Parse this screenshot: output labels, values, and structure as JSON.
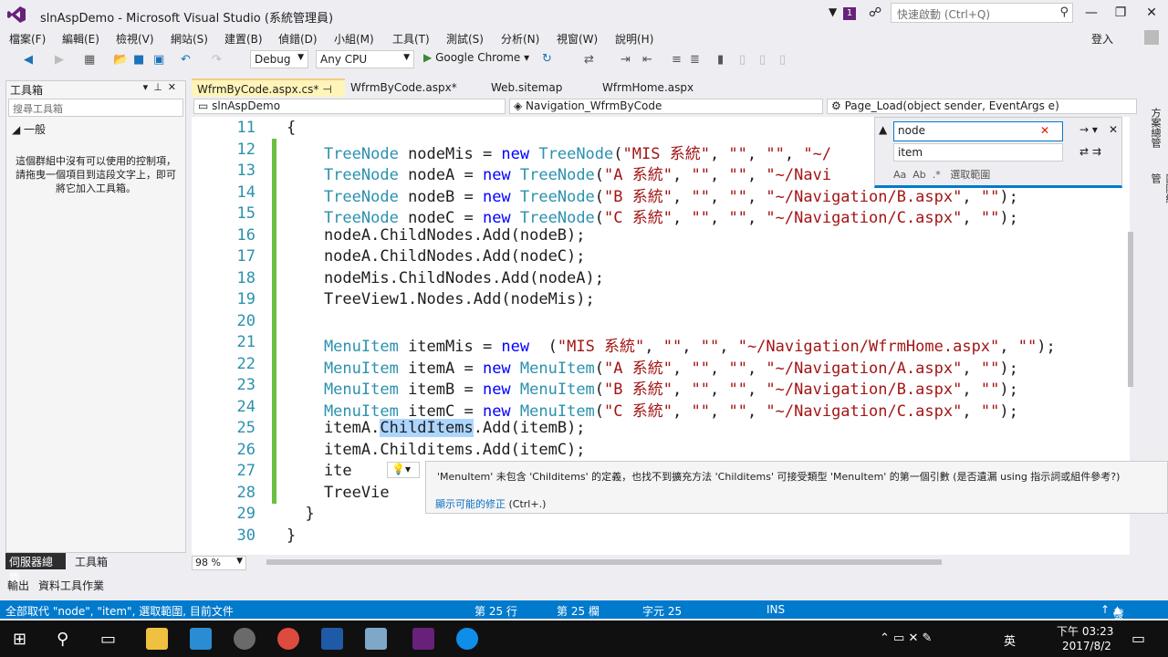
{
  "window": {
    "title": "slnAspDemo - Microsoft Visual Studio (系統管理員)",
    "notification_count": "1",
    "quick_launch_placeholder": "快速啟動 (Ctrl+Q)",
    "sign_in": "登入"
  },
  "menu": [
    "檔案(F)",
    "編輯(E)",
    "檢視(V)",
    "網站(S)",
    "建置(B)",
    "偵錯(D)",
    "小組(M)",
    "工具(T)",
    "測試(S)",
    "分析(N)",
    "視窗(W)",
    "說明(H)"
  ],
  "toolbar": {
    "config": "Debug",
    "platform": "Any CPU",
    "run_target": "Google Chrome"
  },
  "toolbox": {
    "title": "工具箱",
    "search_placeholder": "搜尋工具箱",
    "group": "一般",
    "empty_message": "這個群組中沒有可以使用的控制項，請拖曳一個項目到這段文字上，即可將它加入工具箱。"
  },
  "bottom_tabs": [
    "伺服器總管",
    "工具箱"
  ],
  "pane_tabs": [
    "輸出",
    "資料工具作業"
  ],
  "file_tabs": [
    {
      "label": "WfrmByCode.aspx.cs*",
      "active": true
    },
    {
      "label": "WfrmByCode.aspx*",
      "active": false
    },
    {
      "label": "Web.sitemap",
      "active": false
    },
    {
      "label": "WfrmHome.aspx",
      "active": false
    }
  ],
  "navbar": {
    "project": "slnAspDemo",
    "class": "Navigation_WfrmByCode",
    "member": "Page_Load(object sender, EventArgs e)"
  },
  "code_lines": [
    {
      "n": "11",
      "parts": [
        [
          "",
          "{"
        ]
      ]
    },
    {
      "n": "12",
      "parts": [
        [
          "ty",
          "    TreeNode"
        ],
        [
          "",
          " nodeMis = "
        ],
        [
          "kw",
          "new"
        ],
        [
          "ty",
          " TreeNode"
        ],
        [
          "",
          "("
        ],
        [
          "st",
          "\"MIS 系統\""
        ],
        [
          "",
          ", "
        ],
        [
          "st",
          "\"\""
        ],
        [
          "",
          ", "
        ],
        [
          "st",
          "\"\""
        ],
        [
          "",
          ", "
        ],
        [
          "st",
          "\"~/"
        ]
      ]
    },
    {
      "n": "13",
      "parts": [
        [
          "ty",
          "    TreeNode"
        ],
        [
          "",
          " nodeA = "
        ],
        [
          "kw",
          "new"
        ],
        [
          "ty",
          " TreeNode"
        ],
        [
          "",
          "("
        ],
        [
          "st",
          "\"A 系統\""
        ],
        [
          "",
          ", "
        ],
        [
          "st",
          "\"\""
        ],
        [
          "",
          ", "
        ],
        [
          "st",
          "\"\""
        ],
        [
          "",
          ", "
        ],
        [
          "st",
          "\"~/Navi"
        ]
      ]
    },
    {
      "n": "14",
      "parts": [
        [
          "ty",
          "    TreeNode"
        ],
        [
          "",
          " nodeB = "
        ],
        [
          "kw",
          "new"
        ],
        [
          "ty",
          " TreeNode"
        ],
        [
          "",
          "("
        ],
        [
          "st",
          "\"B 系統\""
        ],
        [
          "",
          ", "
        ],
        [
          "st",
          "\"\""
        ],
        [
          "",
          ", "
        ],
        [
          "st",
          "\"\""
        ],
        [
          "",
          ", "
        ],
        [
          "st",
          "\"~/Navigation/B.aspx\""
        ],
        [
          "",
          ", "
        ],
        [
          "st",
          "\"\""
        ],
        [
          "",
          ");"
        ]
      ]
    },
    {
      "n": "15",
      "parts": [
        [
          "ty",
          "    TreeNode"
        ],
        [
          "",
          " nodeC = "
        ],
        [
          "kw",
          "new"
        ],
        [
          "ty",
          " TreeNode"
        ],
        [
          "",
          "("
        ],
        [
          "st",
          "\"C 系統\""
        ],
        [
          "",
          ", "
        ],
        [
          "st",
          "\"\""
        ],
        [
          "",
          ", "
        ],
        [
          "st",
          "\"\""
        ],
        [
          "",
          ", "
        ],
        [
          "st",
          "\"~/Navigation/C.aspx\""
        ],
        [
          "",
          ", "
        ],
        [
          "st",
          "\"\""
        ],
        [
          "",
          ");"
        ]
      ]
    },
    {
      "n": "16",
      "parts": [
        [
          "",
          "    nodeA.ChildNodes.Add(nodeB);"
        ]
      ]
    },
    {
      "n": "17",
      "parts": [
        [
          "",
          "    nodeA.ChildNodes.Add(nodeC);"
        ]
      ]
    },
    {
      "n": "18",
      "parts": [
        [
          "",
          "    nodeMis.ChildNodes.Add(nodeA);"
        ]
      ]
    },
    {
      "n": "19",
      "parts": [
        [
          "",
          "    TreeView1.Nodes.Add(nodeMis);"
        ]
      ]
    },
    {
      "n": "20",
      "parts": [
        [
          "",
          ""
        ]
      ]
    },
    {
      "n": "21",
      "parts": [
        [
          "ty",
          "    MenuItem"
        ],
        [
          "",
          " itemMis = "
        ],
        [
          "kw",
          "new"
        ],
        [
          "",
          "  ("
        ],
        [
          "st",
          "\"MIS 系統\""
        ],
        [
          "",
          ", "
        ],
        [
          "st",
          "\"\""
        ],
        [
          "",
          ", "
        ],
        [
          "st",
          "\"\""
        ],
        [
          "",
          ", "
        ],
        [
          "st",
          "\"~/Navigation/WfrmHome.aspx\""
        ],
        [
          "",
          ", "
        ],
        [
          "st",
          "\"\""
        ],
        [
          "",
          ");"
        ]
      ]
    },
    {
      "n": "22",
      "parts": [
        [
          "ty",
          "    MenuItem"
        ],
        [
          "",
          " itemA = "
        ],
        [
          "kw",
          "new"
        ],
        [
          "ty",
          " MenuItem"
        ],
        [
          "",
          "("
        ],
        [
          "st",
          "\"A 系統\""
        ],
        [
          "",
          ", "
        ],
        [
          "st",
          "\"\""
        ],
        [
          "",
          ", "
        ],
        [
          "st",
          "\"\""
        ],
        [
          "",
          ", "
        ],
        [
          "st",
          "\"~/Navigation/A.aspx\""
        ],
        [
          "",
          ", "
        ],
        [
          "st",
          "\"\""
        ],
        [
          "",
          ");"
        ]
      ]
    },
    {
      "n": "23",
      "parts": [
        [
          "ty",
          "    MenuItem"
        ],
        [
          "",
          " itemB = "
        ],
        [
          "kw",
          "new"
        ],
        [
          "ty",
          " MenuItem"
        ],
        [
          "",
          "("
        ],
        [
          "st",
          "\"B 系統\""
        ],
        [
          "",
          ", "
        ],
        [
          "st",
          "\"\""
        ],
        [
          "",
          ", "
        ],
        [
          "st",
          "\"\""
        ],
        [
          "",
          ", "
        ],
        [
          "st",
          "\"~/Navigation/B.aspx\""
        ],
        [
          "",
          ", "
        ],
        [
          "st",
          "\"\""
        ],
        [
          "",
          ");"
        ]
      ]
    },
    {
      "n": "24",
      "parts": [
        [
          "ty",
          "    MenuItem"
        ],
        [
          "",
          " itemC = "
        ],
        [
          "kw",
          "new"
        ],
        [
          "ty",
          " MenuItem"
        ],
        [
          "",
          "("
        ],
        [
          "st",
          "\"C 系統\""
        ],
        [
          "",
          ", "
        ],
        [
          "st",
          "\"\""
        ],
        [
          "",
          ", "
        ],
        [
          "st",
          "\"\""
        ],
        [
          "",
          ", "
        ],
        [
          "st",
          "\"~/Navigation/C.aspx\""
        ],
        [
          "",
          ", "
        ],
        [
          "st",
          "\"\""
        ],
        [
          "",
          ");"
        ]
      ]
    },
    {
      "n": "25",
      "parts": [
        [
          "",
          "    itemA."
        ],
        [
          "sel",
          "ChildItems"
        ],
        [
          "",
          ".Add(itemB);"
        ]
      ]
    },
    {
      "n": "26",
      "parts": [
        [
          "",
          "    itemA.Childitems.Add(itemC);"
        ]
      ]
    },
    {
      "n": "27",
      "parts": [
        [
          "",
          "    ite"
        ]
      ]
    },
    {
      "n": "28",
      "parts": [
        [
          "",
          "    TreeVie"
        ]
      ]
    },
    {
      "n": "29",
      "parts": [
        [
          "",
          "  }"
        ]
      ]
    },
    {
      "n": "30",
      "parts": [
        [
          "",
          "}"
        ]
      ]
    }
  ],
  "find": {
    "search": "node",
    "replace": "item",
    "scope": "選取範圍"
  },
  "tooltip": {
    "message": "'MenuItem' 未包含 'Childitems' 的定義，也找不到擴充方法 'Childitems' 可接受類型 'MenuItem' 的第一個引數 (是否遺漏 using 指示詞或組件參考?)",
    "fix_link": "顯示可能的修正",
    "fix_shortcut": "(Ctrl+.)"
  },
  "zoom": "98 %",
  "status": {
    "message": "全部取代 \"node\", \"item\", 選取範圍, 目前文件",
    "line": "第 25 行",
    "col": "第 25 欄",
    "char": "字元 25",
    "mode": "INS",
    "publish": "發行"
  },
  "side_tabs": [
    "方案總管",
    "團隊總管"
  ],
  "clock": {
    "time": "下午 03:23",
    "date": "2017/8/2"
  },
  "ime": "英",
  "colors": {
    "accent": "#007acc",
    "keyword": "#0000ff",
    "type": "#2b91af",
    "string": "#a31515"
  }
}
